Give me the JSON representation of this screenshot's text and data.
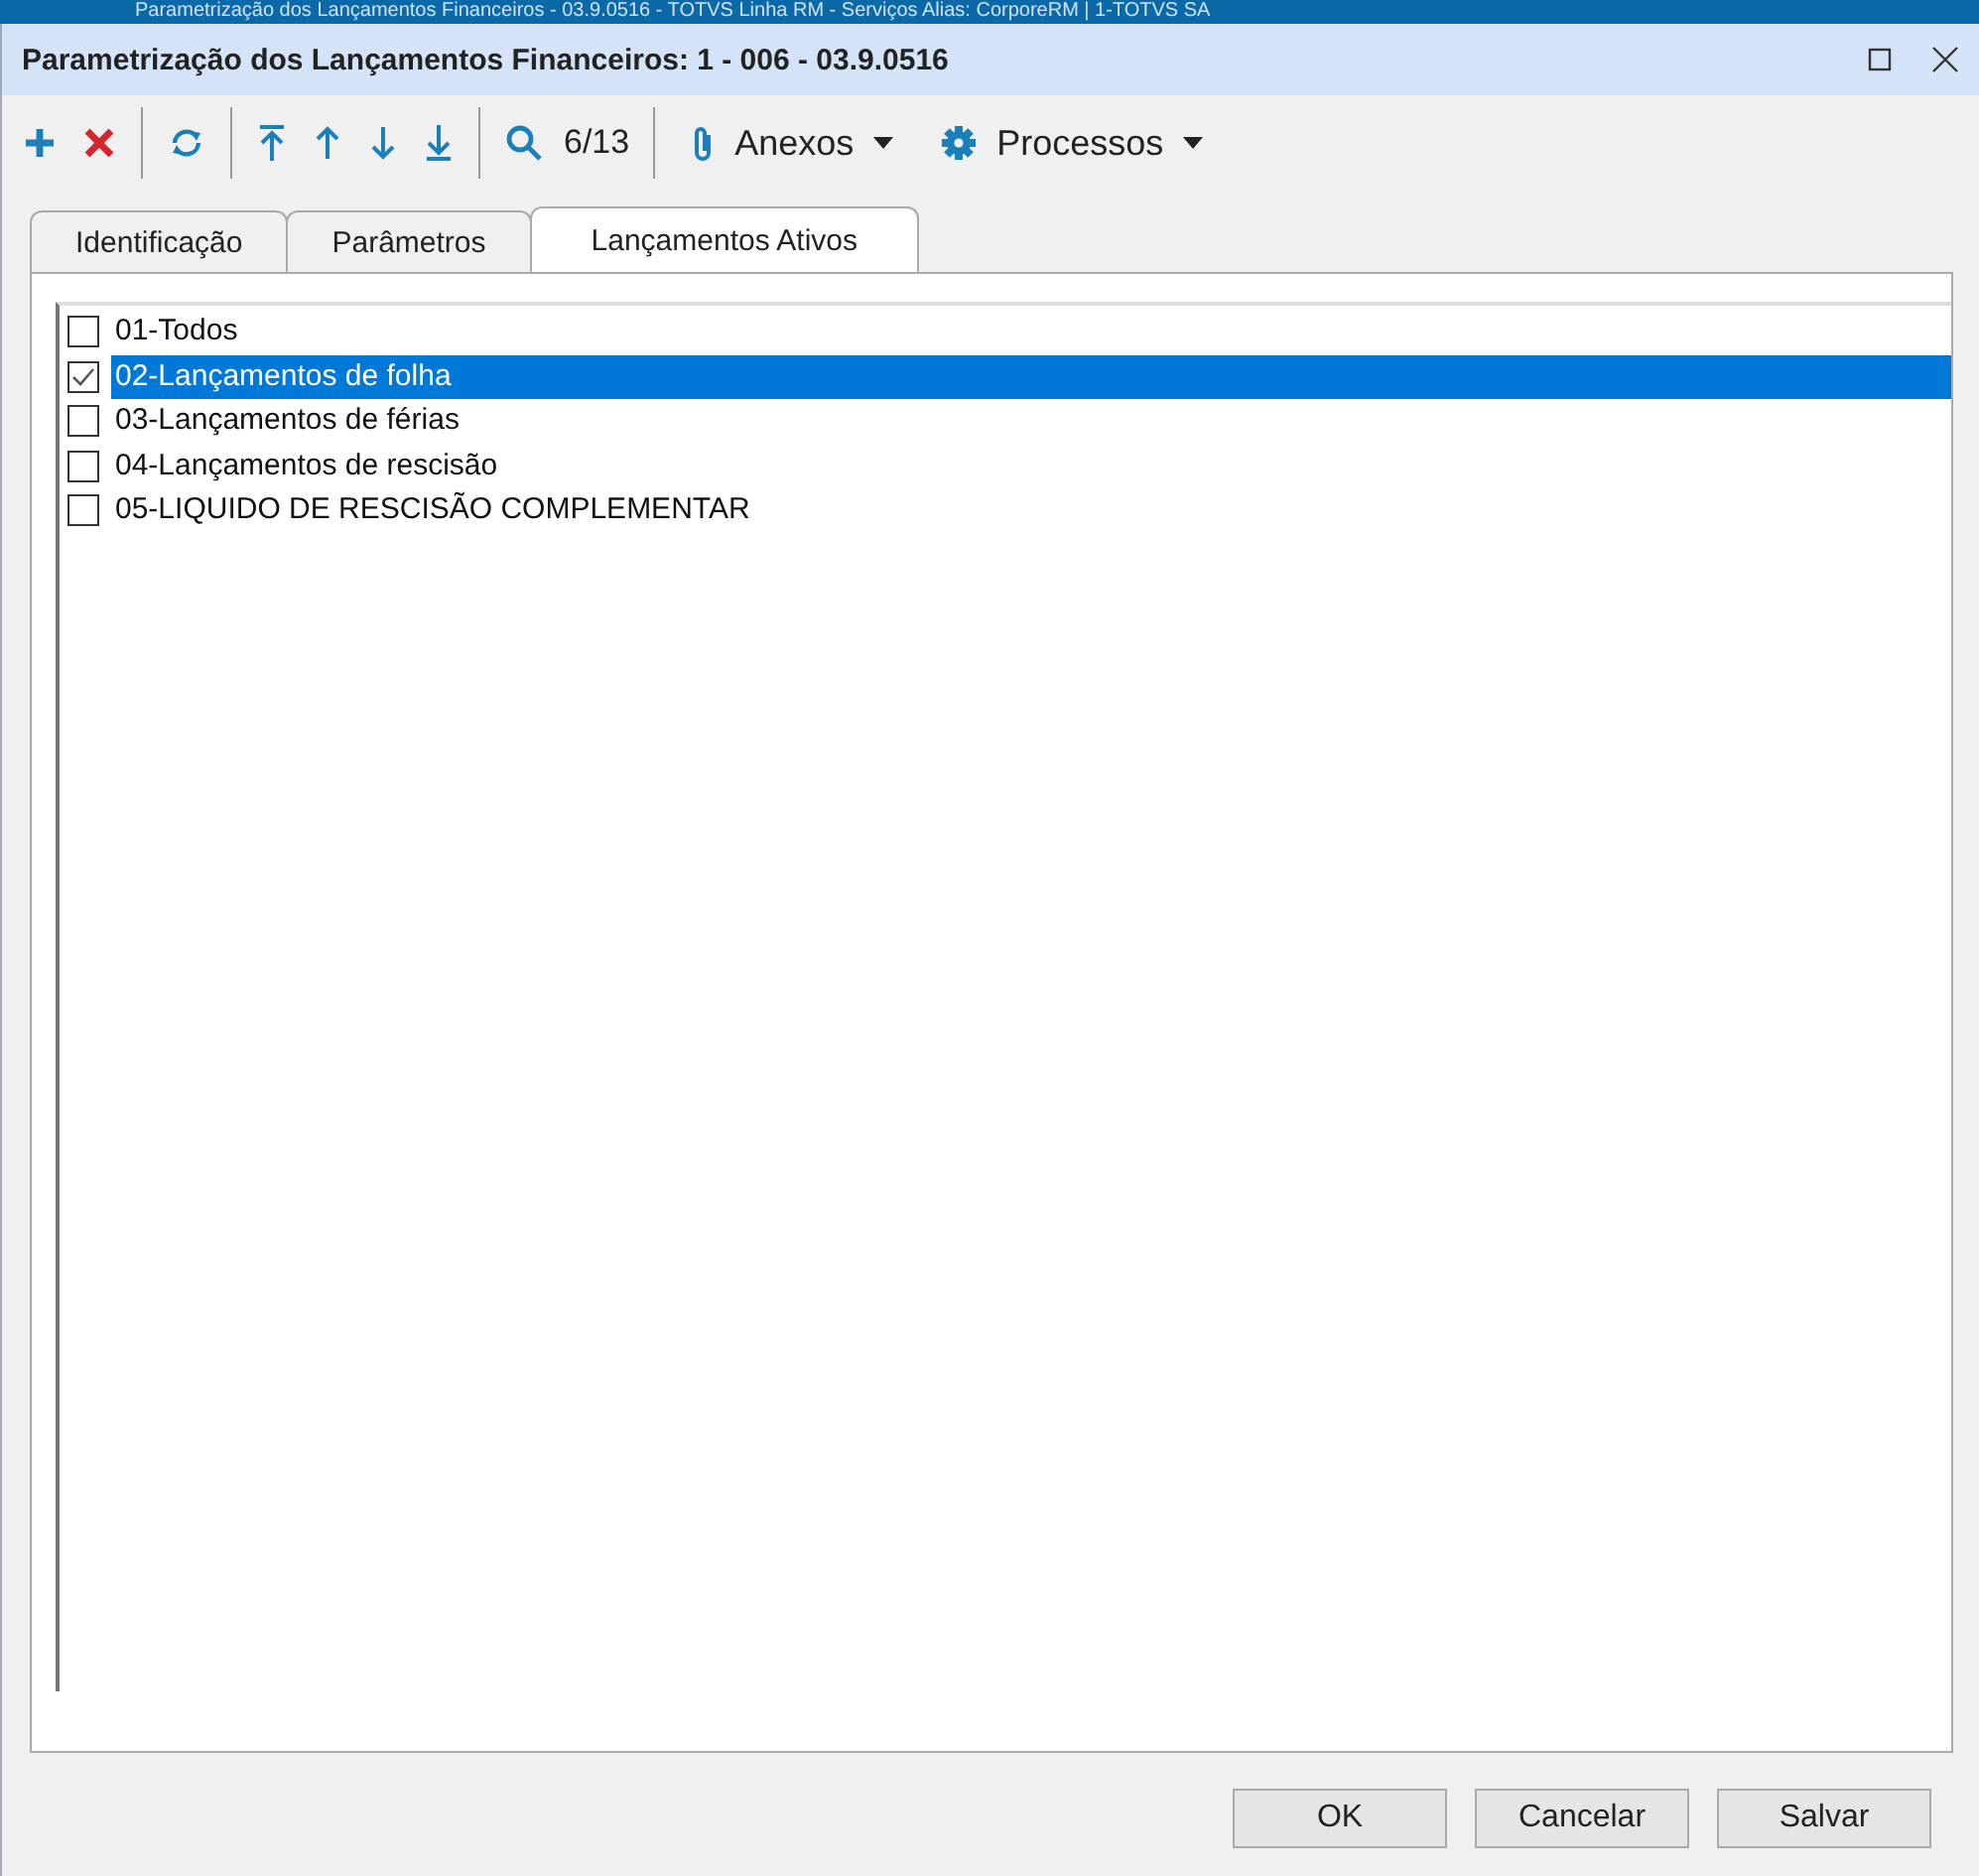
{
  "parent_window": {
    "title": "Parametrização dos Lançamentos Financeiros - 03.9.0516 - TOTVS Linha RM - Serviços  Alias: CorporeRM | 1-TOTVS SA"
  },
  "window": {
    "title": "Parametrização dos Lançamentos Financeiros: 1 - 006 - 03.9.0516"
  },
  "toolbar": {
    "record_counter": "6/13",
    "menus": [
      {
        "label": "Anexos",
        "kind": "attach"
      },
      {
        "label": "Processos",
        "kind": "gear"
      }
    ]
  },
  "tabs": [
    {
      "label": "Identificação",
      "selected": false
    },
    {
      "label": "Parâmetros",
      "selected": false
    },
    {
      "label": "Lançamentos Ativos",
      "selected": true
    }
  ],
  "items": [
    {
      "label": "01-Todos",
      "checked": false,
      "selected": false
    },
    {
      "label": "02-Lançamentos de folha",
      "checked": true,
      "selected": true
    },
    {
      "label": "03-Lançamentos de férias",
      "checked": false,
      "selected": false
    },
    {
      "label": "04-Lançamentos de rescisão",
      "checked": false,
      "selected": false
    },
    {
      "label": "05-LIQUIDO DE RESCISÃO COMPLEMENTAR",
      "checked": false,
      "selected": false
    }
  ],
  "buttons": [
    "OK",
    "Cancelar",
    "Salvar"
  ]
}
